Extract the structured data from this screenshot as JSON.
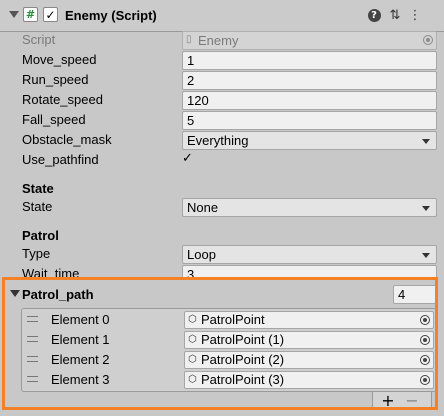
{
  "header": {
    "title": "Enemy (Script)",
    "script_glyph": "#",
    "enabled_check": "✓",
    "help_glyph": "?",
    "settings_glyph": "⇅",
    "menu_glyph": "⋮"
  },
  "fields": {
    "script": {
      "label": "Script",
      "value": "Enemy"
    },
    "move_speed": {
      "label": "Move_speed",
      "value": "1"
    },
    "run_speed": {
      "label": "Run_speed",
      "value": "2"
    },
    "rotate_speed": {
      "label": "Rotate_speed",
      "value": "120"
    },
    "fall_speed": {
      "label": "Fall_speed",
      "value": "5"
    },
    "obstacle_mask": {
      "label": "Obstacle_mask",
      "value": "Everything"
    },
    "use_pathfind": {
      "label": "Use_pathfind",
      "check": "✓"
    }
  },
  "state_section": {
    "header": "State",
    "state": {
      "label": "State",
      "value": "None"
    }
  },
  "patrol_section": {
    "header": "Patrol",
    "type": {
      "label": "Type",
      "value": "Loop"
    },
    "wait_time": {
      "label": "Wait_time",
      "value": "3"
    }
  },
  "patrol_path": {
    "label": "Patrol_path",
    "count": "4",
    "elements": [
      {
        "label": "Element 0",
        "value": "PatrolPoint"
      },
      {
        "label": "Element 1",
        "value": "PatrolPoint (1)"
      },
      {
        "label": "Element 2",
        "value": "PatrolPoint (2)"
      },
      {
        "label": "Element 3",
        "value": "PatrolPoint (3)"
      }
    ],
    "add_glyph": "+",
    "remove_glyph": "−"
  },
  "colors": {
    "highlight": "#f58025",
    "panel": "#c8c8c8"
  }
}
